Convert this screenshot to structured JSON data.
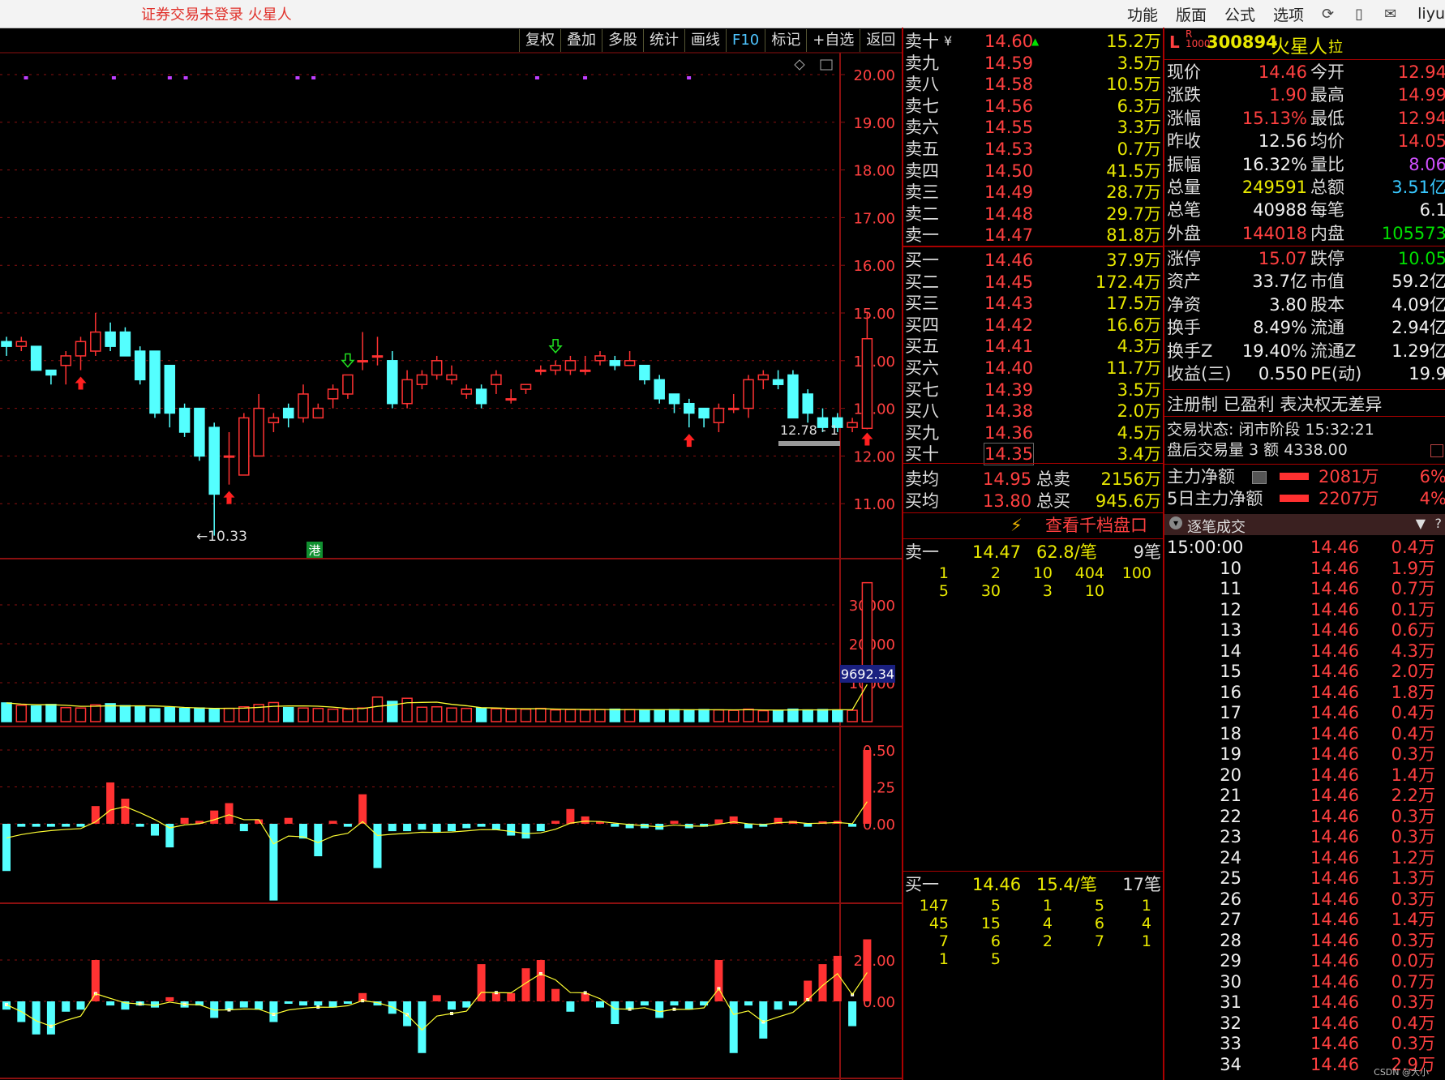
{
  "app": {
    "title": "证券交易未登录  火星人",
    "menu": [
      "功能",
      "版面",
      "公式",
      "选项"
    ],
    "user": "liyu"
  },
  "toolbar": [
    "复权",
    "叠加",
    "多股",
    "统计",
    "画线",
    "F10",
    "标记",
    "+自选",
    "返回"
  ],
  "price_axis": [
    "20.00",
    "19.00",
    "18.00",
    "17.00",
    "16.00",
    "15.00",
    "14.00",
    "13.00",
    "12.00",
    "11.00"
  ],
  "volume_axis": [
    "30000",
    "20000",
    "10000"
  ],
  "volume_marker": "9692.34",
  "ind1_axis": [
    "0.50",
    "0.25",
    "0.00"
  ],
  "ind2_axis": [
    "20.00",
    "0.00"
  ],
  "annotations": {
    "low_label": "←10.33",
    "last_label": "12.78 - 1",
    "hk_badge": "港"
  },
  "colors": {
    "up": "#ff3232",
    "down": "#54ffff",
    "grid": "#8a1010",
    "ma": "#ffff33",
    "accent": "#e8e800"
  },
  "chart_data": {
    "type": "candlestick",
    "open": [
      14.4,
      14.3,
      14.3,
      13.8,
      13.9,
      14.1,
      14.2,
      14.6,
      14.6,
      14.2,
      14.2,
      13.9,
      13.0,
      13.0,
      12.6,
      12.0,
      11.6,
      12.0,
      12.7,
      13.0,
      12.8,
      12.8,
      13.2,
      13.3,
      14.0,
      14.1,
      14.0,
      13.1,
      13.5,
      13.7,
      13.6,
      13.3,
      13.4,
      13.5,
      13.2,
      13.4,
      13.8,
      13.8,
      13.8,
      13.8,
      14.0,
      14.0,
      13.9,
      13.9,
      13.6,
      13.3,
      13.1,
      13.0,
      12.7,
      13.0,
      13.0,
      13.6,
      13.6,
      13.7,
      13.3,
      12.8,
      12.8,
      12.6,
      12.58
    ],
    "close": [
      14.3,
      14.4,
      13.8,
      13.7,
      14.1,
      14.4,
      14.6,
      14.3,
      14.1,
      13.6,
      12.9,
      12.9,
      12.5,
      12.0,
      11.2,
      12.0,
      12.8,
      13.0,
      12.8,
      12.8,
      13.3,
      13.0,
      13.4,
      13.7,
      14.0,
      14.1,
      13.1,
      13.6,
      13.7,
      14.0,
      13.7,
      13.4,
      13.1,
      13.7,
      13.2,
      13.5,
      13.8,
      13.9,
      14.0,
      13.8,
      14.1,
      13.9,
      14.0,
      13.6,
      13.2,
      13.1,
      12.9,
      12.8,
      13.0,
      13.0,
      13.6,
      13.7,
      13.5,
      12.8,
      12.9,
      12.6,
      12.6,
      12.7,
      14.46
    ],
    "high": [
      14.5,
      14.5,
      14.3,
      13.8,
      14.2,
      14.5,
      15.0,
      14.8,
      14.7,
      14.3,
      14.2,
      13.9,
      13.1,
      13.0,
      12.7,
      12.5,
      12.9,
      13.3,
      12.9,
      13.1,
      13.5,
      13.1,
      13.5,
      13.7,
      14.6,
      14.5,
      14.2,
      13.8,
      13.8,
      14.1,
      13.9,
      13.5,
      13.5,
      13.8,
      13.4,
      13.5,
      13.9,
      14.0,
      14.1,
      14.1,
      14.2,
      14.1,
      14.2,
      13.9,
      13.7,
      13.3,
      13.2,
      13.0,
      13.1,
      13.3,
      13.7,
      13.8,
      13.8,
      13.8,
      13.4,
      13.0,
      12.9,
      12.8,
      15.0
    ],
    "low": [
      14.1,
      14.2,
      13.8,
      13.5,
      13.5,
      13.8,
      14.1,
      14.2,
      14.1,
      13.5,
      12.8,
      12.6,
      12.4,
      11.9,
      10.33,
      11.4,
      11.6,
      12.0,
      12.5,
      12.6,
      12.7,
      12.8,
      13.0,
      13.2,
      13.8,
      13.9,
      13.0,
      13.0,
      13.4,
      13.6,
      13.5,
      13.2,
      13.0,
      13.3,
      13.1,
      13.3,
      13.7,
      13.7,
      13.7,
      13.7,
      13.9,
      13.8,
      13.9,
      13.5,
      13.1,
      12.9,
      12.6,
      12.6,
      12.5,
      12.9,
      12.8,
      13.4,
      13.4,
      12.8,
      12.7,
      12.5,
      12.5,
      12.5,
      12.56
    ],
    "volume": [
      4800,
      4200,
      4000,
      4400,
      3600,
      3500,
      4300,
      4600,
      4100,
      3800,
      3300,
      3600,
      3400,
      3500,
      3200,
      3400,
      3800,
      4400,
      4900,
      3600,
      3500,
      3400,
      3200,
      3200,
      3500,
      6300,
      5200,
      6000,
      3700,
      3800,
      3500,
      3400,
      3500,
      3300,
      3200,
      3200,
      3400,
      3000,
      3100,
      3000,
      3100,
      3200,
      3100,
      3000,
      3000,
      3100,
      3000,
      3100,
      3000,
      2900,
      3200,
      2800,
      2900,
      3200,
      3000,
      3100,
      3000,
      2900,
      35700
    ],
    "ind1": [
      -0.32,
      -0.02,
      -0.02,
      -0.02,
      -0.02,
      -0.02,
      0.12,
      0.28,
      0.17,
      -0.02,
      -0.08,
      -0.16,
      0.04,
      0.02,
      0.09,
      0.14,
      -0.05,
      0.03,
      -0.52,
      0.04,
      -0.1,
      -0.22,
      0.02,
      -0.02,
      0.2,
      -0.3,
      -0.05,
      -0.05,
      -0.04,
      -0.06,
      -0.05,
      -0.03,
      -0.02,
      -0.04,
      -0.08,
      -0.1,
      -0.05,
      0.02,
      0.1,
      0.05,
      0.01,
      -0.02,
      -0.03,
      -0.03,
      -0.04,
      0.02,
      -0.03,
      -0.02,
      0.03,
      0.05,
      -0.03,
      -0.02,
      0.04,
      0.02,
      -0.02,
      0.01,
      0.02,
      -0.02,
      0.5
    ],
    "ind2": [
      -4,
      -10,
      -16,
      -16,
      -5,
      -4,
      20,
      -2,
      -4,
      -2,
      -3,
      2,
      -3,
      -2,
      -8,
      -4,
      -3,
      -4,
      -10,
      -1,
      -2,
      -2,
      -3,
      -1,
      4,
      -2,
      -6,
      -12,
      -25,
      3,
      -4,
      -3,
      18,
      4,
      4,
      16,
      20,
      6,
      -5,
      4,
      -3,
      -11,
      -4,
      -2,
      -8,
      -2,
      -4,
      -2,
      20,
      -25,
      -2,
      -18,
      -4,
      -2,
      10,
      18,
      22,
      -12,
      30
    ]
  },
  "order_book": {
    "sell": [
      {
        "label": "卖十",
        "price": "14.60",
        "vol": "15.2万"
      },
      {
        "label": "卖九",
        "price": "14.59",
        "vol": "3.5万"
      },
      {
        "label": "卖八",
        "price": "14.58",
        "vol": "10.5万"
      },
      {
        "label": "卖七",
        "price": "14.56",
        "vol": "6.3万"
      },
      {
        "label": "卖六",
        "price": "14.55",
        "vol": "3.3万"
      },
      {
        "label": "卖五",
        "price": "14.53",
        "vol": "0.7万"
      },
      {
        "label": "卖四",
        "price": "14.50",
        "vol": "41.5万"
      },
      {
        "label": "卖三",
        "price": "14.49",
        "vol": "28.7万"
      },
      {
        "label": "卖二",
        "price": "14.48",
        "vol": "29.7万"
      },
      {
        "label": "卖一",
        "price": "14.47",
        "vol": "81.8万"
      }
    ],
    "buy": [
      {
        "label": "买一",
        "price": "14.46",
        "vol": "37.9万"
      },
      {
        "label": "买二",
        "price": "14.45",
        "vol": "172.4万"
      },
      {
        "label": "买三",
        "price": "14.43",
        "vol": "17.5万"
      },
      {
        "label": "买四",
        "price": "14.42",
        "vol": "16.6万"
      },
      {
        "label": "买五",
        "price": "14.41",
        "vol": "4.3万"
      },
      {
        "label": "买六",
        "price": "14.40",
        "vol": "11.7万"
      },
      {
        "label": "买七",
        "price": "14.39",
        "vol": "3.5万"
      },
      {
        "label": "买八",
        "price": "14.38",
        "vol": "2.0万"
      },
      {
        "label": "买九",
        "price": "14.36",
        "vol": "4.5万"
      },
      {
        "label": "买十",
        "price": "14.35",
        "vol": "3.4万"
      }
    ],
    "sell_currency_mark": "¥",
    "avg_sell": {
      "label": "卖均",
      "price": "14.95",
      "total_label": "总卖",
      "total": "2156万"
    },
    "avg_buy": {
      "label": "买均",
      "price": "13.80",
      "total_label": "总买",
      "total": "945.6万"
    },
    "thousand_link": "查看千档盘口",
    "sell1_queue": {
      "label": "卖一",
      "price": "14.47",
      "per": "62.8/笔",
      "count": "9笔",
      "rows": [
        [
          "1",
          "2",
          "10",
          "404",
          "100"
        ],
        [
          "5",
          "30",
          "3",
          "10",
          ""
        ]
      ]
    },
    "buy1_queue": {
      "label": "买一",
      "price": "14.46",
      "per": "15.4/笔",
      "count": "17笔",
      "rows": [
        [
          "147",
          "5",
          "1",
          "5",
          "1"
        ],
        [
          "45",
          "15",
          "4",
          "6",
          "4"
        ],
        [
          "7",
          "6",
          "2",
          "7",
          "1"
        ],
        [
          "1",
          "5",
          "",
          "",
          ""
        ]
      ]
    }
  },
  "quote": {
    "code": "300894",
    "name": "火星人",
    "badge_l": "L",
    "badge_r": "R",
    "badge_num": "1000",
    "badge_suffix": "拉",
    "rows": [
      {
        "l1": "现价",
        "v1": "14.46",
        "l2": "今开",
        "v2": "12.94"
      },
      {
        "l1": "涨跌",
        "v1": "1.90",
        "l2": "最高",
        "v2": "14.99"
      },
      {
        "l1": "涨幅",
        "v1": "15.13%",
        "l2": "最低",
        "v2": "12.94"
      },
      {
        "l1": "昨收",
        "v1": "12.56",
        "l2": "均价",
        "v2": "14.05"
      },
      {
        "l1": "振幅",
        "v1": "16.32%",
        "l2": "量比",
        "v2": "8.06"
      },
      {
        "l1": "总量",
        "v1": "249591",
        "l2": "总额",
        "v2": "3.51亿"
      },
      {
        "l1": "总笔",
        "v1": "40988",
        "l2": "每笔",
        "v2": "6.1"
      },
      {
        "l1": "外盘",
        "v1": "144018",
        "l2": "内盘",
        "v2": "105573"
      }
    ],
    "rows2": [
      {
        "l1": "涨停",
        "v1": "15.07",
        "l2": "跌停",
        "v2": "10.05"
      },
      {
        "l1": "资产",
        "v1": "33.7亿",
        "l2": "市值",
        "v2": "59.2亿"
      },
      {
        "l1": "净资",
        "v1": "3.80",
        "l2": "股本",
        "v2": "4.09亿"
      },
      {
        "l1": "换手",
        "v1": "8.49%",
        "l2": "流通",
        "v2": "2.94亿"
      },
      {
        "l1": "换手Z",
        "v1": "19.40%",
        "l2": "流通Z",
        "v2": "1.29亿"
      },
      {
        "l1": "收益(三)",
        "v1": "0.550",
        "l2": "PE(动)",
        "v2": "19.9"
      }
    ],
    "reg": "注册制 已盈利 表决权无差异",
    "status": "交易状态: 闭市阶段 15:32:21",
    "after_hours": "盘后交易量 3 额 4338.00",
    "main_net": {
      "label": "主力净额",
      "value": "2081万",
      "pct": "6%"
    },
    "main_net5": {
      "label": "5日主力净额",
      "value": "2207万",
      "pct": "4%"
    }
  },
  "ticks": {
    "title": "逐笔成交",
    "rows": [
      {
        "t": "15:00:00",
        "p": "14.46",
        "v": "0.4万"
      },
      {
        "t": "10",
        "p": "14.46",
        "v": "1.9万"
      },
      {
        "t": "11",
        "p": "14.46",
        "v": "0.7万"
      },
      {
        "t": "12",
        "p": "14.46",
        "v": "0.1万"
      },
      {
        "t": "13",
        "p": "14.46",
        "v": "0.6万"
      },
      {
        "t": "14",
        "p": "14.46",
        "v": "4.3万"
      },
      {
        "t": "15",
        "p": "14.46",
        "v": "2.0万"
      },
      {
        "t": "16",
        "p": "14.46",
        "v": "1.8万"
      },
      {
        "t": "17",
        "p": "14.46",
        "v": "0.4万"
      },
      {
        "t": "18",
        "p": "14.46",
        "v": "0.4万"
      },
      {
        "t": "19",
        "p": "14.46",
        "v": "0.3万"
      },
      {
        "t": "20",
        "p": "14.46",
        "v": "1.4万"
      },
      {
        "t": "21",
        "p": "14.46",
        "v": "2.2万"
      },
      {
        "t": "22",
        "p": "14.46",
        "v": "0.3万"
      },
      {
        "t": "23",
        "p": "14.46",
        "v": "0.3万"
      },
      {
        "t": "24",
        "p": "14.46",
        "v": "1.2万"
      },
      {
        "t": "25",
        "p": "14.46",
        "v": "1.3万"
      },
      {
        "t": "26",
        "p": "14.46",
        "v": "0.3万"
      },
      {
        "t": "27",
        "p": "14.46",
        "v": "1.4万"
      },
      {
        "t": "28",
        "p": "14.46",
        "v": "0.3万"
      },
      {
        "t": "29",
        "p": "14.46",
        "v": "0.0万"
      },
      {
        "t": "30",
        "p": "14.46",
        "v": "0.7万"
      },
      {
        "t": "31",
        "p": "14.46",
        "v": "0.3万"
      },
      {
        "t": "32",
        "p": "14.46",
        "v": "0.4万"
      },
      {
        "t": "33",
        "p": "14.46",
        "v": "0.3万"
      },
      {
        "t": "34",
        "p": "14.46",
        "v": "2.9万"
      }
    ]
  },
  "watermark": "CSDN @大小"
}
